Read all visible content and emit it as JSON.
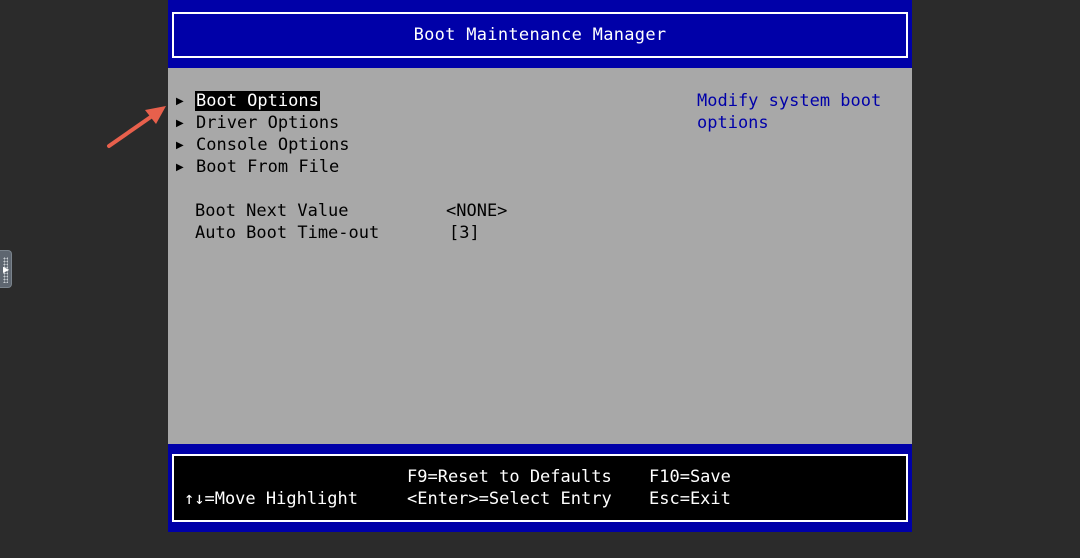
{
  "header": {
    "title": "Boot Maintenance Manager"
  },
  "menu": {
    "items": [
      {
        "label": "Boot Options",
        "selected": true
      },
      {
        "label": "Driver Options",
        "selected": false
      },
      {
        "label": "Console Options",
        "selected": false
      },
      {
        "label": "Boot From File",
        "selected": false
      }
    ]
  },
  "settings": {
    "boot_next": {
      "label": "Boot Next Value",
      "value": "<NONE>"
    },
    "auto_boot": {
      "label": "Auto Boot Time-out",
      "value": "[3]"
    }
  },
  "help": {
    "text": "Modify system boot options"
  },
  "footer": {
    "f9": "F9=Reset to Defaults",
    "f10": "F10=Save",
    "move": "↑↓=Move Highlight",
    "enter": "<Enter>=Select Entry",
    "esc": "Esc=Exit"
  },
  "colors": {
    "bios_blue": "#0000a8",
    "body_gray": "#a8a8a8",
    "highlight": "#000000",
    "annotation_arrow": "#e8604c"
  },
  "icons": {
    "menu_marker": "triangle-right-icon",
    "annotation": "arrow-icon"
  }
}
